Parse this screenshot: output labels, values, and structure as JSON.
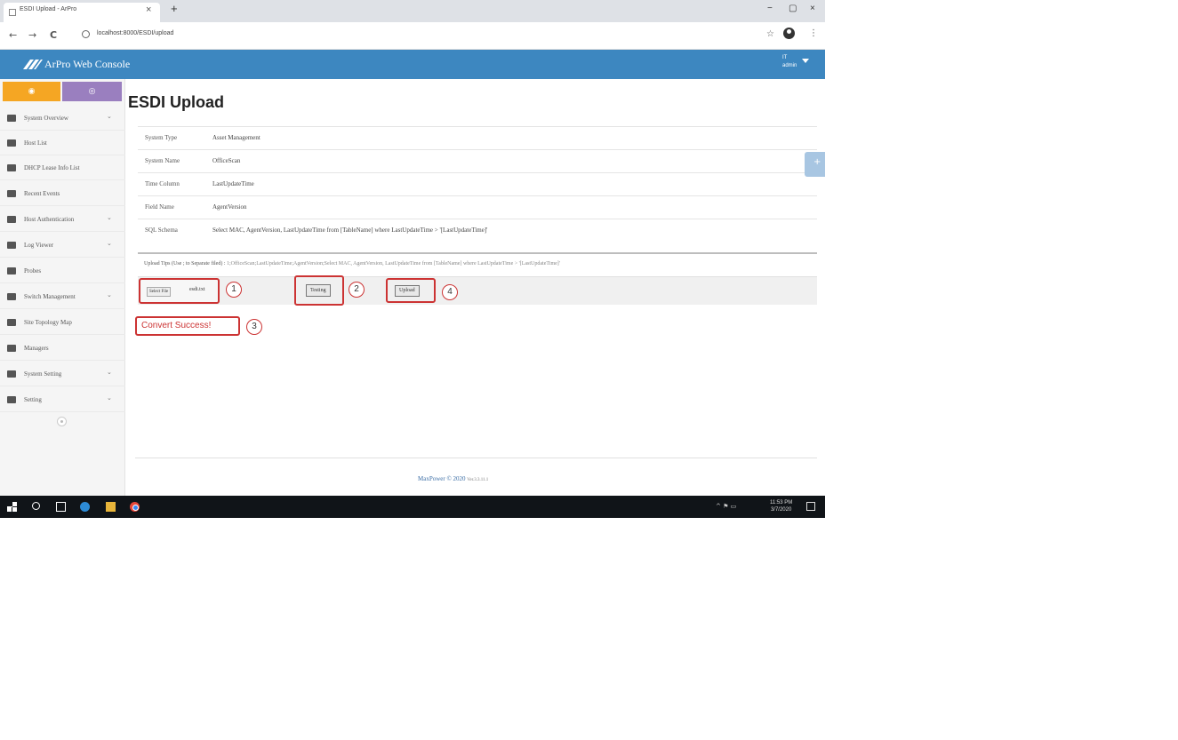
{
  "browser": {
    "tab_title": "ESDI Upload - ArPro",
    "tab_close": "×",
    "new_tab": "+",
    "url": "localhost:8000/ESDI/upload",
    "win_min": "−",
    "win_max": "▢",
    "win_close": "×",
    "back": "←",
    "forward": "→",
    "reload": "C",
    "star": "☆",
    "menu": "⋮"
  },
  "header": {
    "brand": "ArPro Web Console",
    "user_line1": "IT",
    "user_line2": "admin",
    "accent": "#3d87c0"
  },
  "sidebar": {
    "dash_icon": "◉",
    "view_icon": "◎",
    "items": [
      {
        "label": "System Overview",
        "chevron": "⌄"
      },
      {
        "label": "Host List",
        "chevron": ""
      },
      {
        "label": "DHCP Lease Info List",
        "chevron": ""
      },
      {
        "label": "Recent Events",
        "chevron": ""
      },
      {
        "label": "Host Authentication",
        "chevron": "⌄"
      },
      {
        "label": "Log Viewer",
        "chevron": "⌄"
      },
      {
        "label": "Probes",
        "chevron": ""
      },
      {
        "label": "Switch Management",
        "chevron": "⌄"
      },
      {
        "label": "Site Topology Map",
        "chevron": ""
      },
      {
        "label": "Managers",
        "chevron": ""
      },
      {
        "label": "System Setting",
        "chevron": "⌄"
      },
      {
        "label": "Setting",
        "chevron": "⌄"
      }
    ]
  },
  "main": {
    "title": "ESDI Upload",
    "rows": [
      {
        "key": "System Type",
        "value": "Asset Management"
      },
      {
        "key": "System Name",
        "value": "OfficeScan"
      },
      {
        "key": "Time Column",
        "value": "LastUpdateTime"
      },
      {
        "key": "Field Name",
        "value": "AgentVersion"
      },
      {
        "key": "SQL Schema",
        "value": "Select MAC, AgentVersion, LastUpdateTime from [TableName] where LastUpdateTime > '[LastUpdateTime]'"
      }
    ],
    "side_plus": "+",
    "tips_label": "Upload Tips (Use ; to Separate filed) :",
    "tips_value": "1;OfficeScan;LastUpdateTime;AgentVersion;Select MAC, AgentVersion, LastUpdateTime from [TableName] where LastUpdateTime > '[LastUpdateTime]'",
    "choose_file": "Select File",
    "file_name": "esdi.txt",
    "testing_label": "Testing",
    "upload_label": "Upload",
    "success_msg": "Convert Success!",
    "callouts": [
      "1",
      "2",
      "3",
      "4"
    ]
  },
  "footer": {
    "text": "MaxPower © 2020",
    "version": "Ver.3.3.11.1"
  },
  "taskbar": {
    "tray": "^ ⚑ ▭",
    "time": "11:53 PM",
    "date": "3/7/2020"
  }
}
